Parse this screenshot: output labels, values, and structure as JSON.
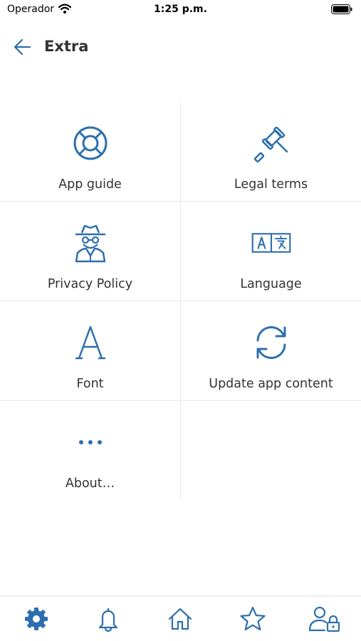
{
  "status": {
    "carrier": "Operador",
    "time": "1:25 p.m."
  },
  "header": {
    "title": "Extra"
  },
  "colors": {
    "accent": "#2d6fae",
    "text": "#333333",
    "divider": "#e9e9e9"
  },
  "menu": [
    {
      "label": "App guide",
      "icon": "lifebuoy-icon"
    },
    {
      "label": "Legal terms",
      "icon": "gavel-icon"
    },
    {
      "label": "Privacy Policy",
      "icon": "spy-icon"
    },
    {
      "label": "Language",
      "icon": "translate-icon"
    },
    {
      "label": "Font",
      "icon": "font-icon"
    },
    {
      "label": "Update app content",
      "icon": "refresh-icon"
    },
    {
      "label": "About…",
      "icon": "more-icon"
    }
  ],
  "tabs": [
    {
      "name": "settings",
      "icon": "gear-icon",
      "active": true
    },
    {
      "name": "notifications",
      "icon": "bell-icon",
      "active": false
    },
    {
      "name": "home",
      "icon": "home-icon",
      "active": false
    },
    {
      "name": "favorites",
      "icon": "star-icon",
      "active": false
    },
    {
      "name": "account",
      "icon": "user-lock-icon",
      "active": false
    }
  ]
}
